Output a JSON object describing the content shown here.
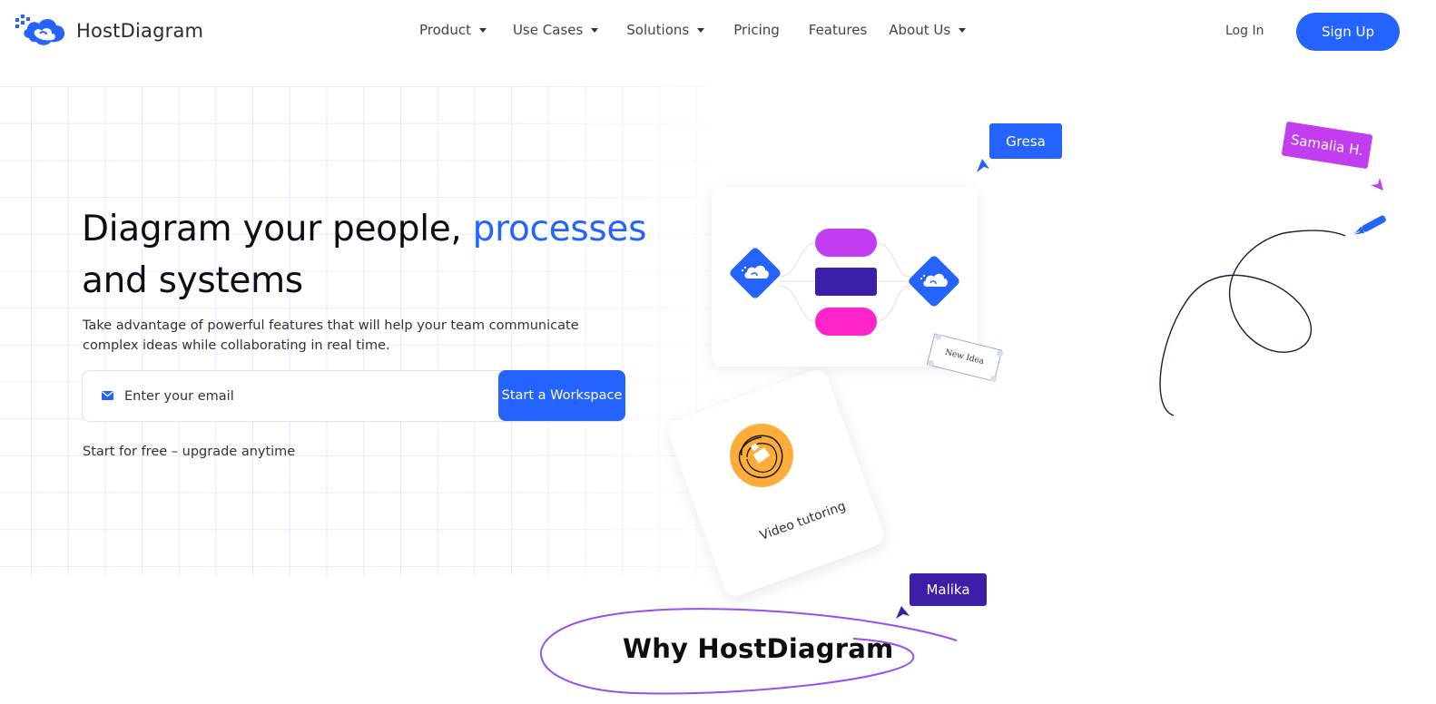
{
  "brand": {
    "name": "HostDiagram",
    "accent": "#2563ff"
  },
  "nav": {
    "items": [
      {
        "label": "Product",
        "dropdown": true
      },
      {
        "label": "Use Cases",
        "dropdown": true
      },
      {
        "label": "Solutions",
        "dropdown": true
      },
      {
        "label": "Pricing",
        "dropdown": false
      },
      {
        "label": "Features",
        "dropdown": false
      },
      {
        "label": "About Us",
        "dropdown": true
      }
    ],
    "login_label": "Log In",
    "signup_label": "Sign Up"
  },
  "hero": {
    "title_start": "Diagram your people, ",
    "title_accent": "processes",
    "title_end": "and systems",
    "subtitle": "Take advantage of powerful features that will help your team communicate complex ideas while collaborating in real time.",
    "email_placeholder": "Enter your email",
    "cta_label": "Start a Workspace",
    "free_note": "Start for free – upgrade anytime"
  },
  "illustration": {
    "cursor_tags": [
      {
        "name": "Gresa",
        "color": "#2563ff"
      },
      {
        "name": "Samalia H.",
        "color": "#c23cf0"
      },
      {
        "name": "Malika",
        "color": "#3b1fa6"
      }
    ],
    "flow_colors": {
      "top": "#c23cf0",
      "middle": "#3b1fa6",
      "bottom": "#ff24c8",
      "node": "#2563ff"
    },
    "sticky_note": "New Idea",
    "video_card_label": "Video tutoring",
    "video_card_icon": "orange-circle-icon"
  },
  "section": {
    "why_title": "Why HostDiagram"
  }
}
